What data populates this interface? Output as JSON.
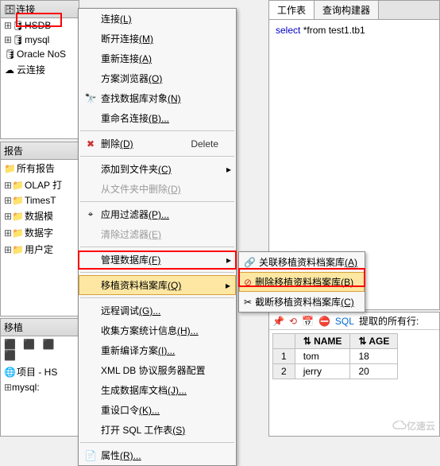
{
  "left_top": {
    "header": "连接",
    "items": [
      "HSDB",
      "mysql",
      "Oracle NoS",
      "云连接"
    ]
  },
  "reports": {
    "header": "报告",
    "items": [
      "所有报告",
      "OLAP 打",
      "TimesT",
      "数据模",
      "数据字",
      "用户定"
    ]
  },
  "migrate": {
    "header": "移植",
    "project": "项目 - HS",
    "sub": "mysql:"
  },
  "editor": {
    "tabs": [
      "工作表",
      "查询构建器"
    ],
    "sql_select": "select",
    "sql_rest": " *from test1.tb1"
  },
  "results": {
    "toolbar_sql": "SQL",
    "toolbar_fetch": "提取的所有行:",
    "cols": [
      "NAME",
      "AGE"
    ],
    "rows": [
      [
        "tom",
        "18"
      ],
      [
        "jerry",
        "20"
      ]
    ]
  },
  "menu": {
    "connect": "连接",
    "connect_k": "(L)",
    "disconnect": "断开连接",
    "disconnect_k": "(M)",
    "reconnect": "重新连接",
    "reconnect_k": "(A)",
    "schema_browser": "方案浏览器",
    "schema_browser_k": "(O)",
    "find_obj": "查找数据库对象",
    "find_obj_k": "(N)",
    "rename_conn": "重命名连接",
    "rename_conn_k": "(B)...",
    "delete": "删除",
    "delete_k": "(D)",
    "delete_acc": "Delete",
    "add_folder": "添加到文件夹",
    "add_folder_k": "(C)",
    "del_folder": "从文件夹中删除",
    "del_folder_k": "(D)",
    "apply_filter": "应用过滤器",
    "apply_filter_k": "(P)...",
    "clear_filter": "清除过滤器",
    "clear_filter_k": "(E)",
    "manage_db": "管理数据库",
    "manage_db_k": "(F)",
    "migrate_repo": "移植资料档案库",
    "migrate_repo_k": "(Q)",
    "remote_debug": "远程调试",
    "remote_debug_k": "(G)...",
    "gather_stats": "收集方案统计信息",
    "gather_stats_k": "(H)...",
    "recompile": "重新编译方案",
    "recompile_k": "(I)...",
    "xmldb": "XML DB 协议服务器配置",
    "gen_doc": "生成数据库文档",
    "gen_doc_k": "(J)...",
    "reset_pwd": "重设口令",
    "reset_pwd_k": "(K)...",
    "open_sql": "打开 SQL 工作表",
    "open_sql_k": "(S)",
    "properties": "属性",
    "properties_k": "(R)..."
  },
  "submenu": {
    "assoc": "关联移植资料档案库",
    "assoc_k": "(A)",
    "delete": "删除移植资料档案库",
    "delete_k": "(B)",
    "truncate": "截断移植资料档案库",
    "truncate_k": "(C)"
  },
  "watermark": "亿速云"
}
